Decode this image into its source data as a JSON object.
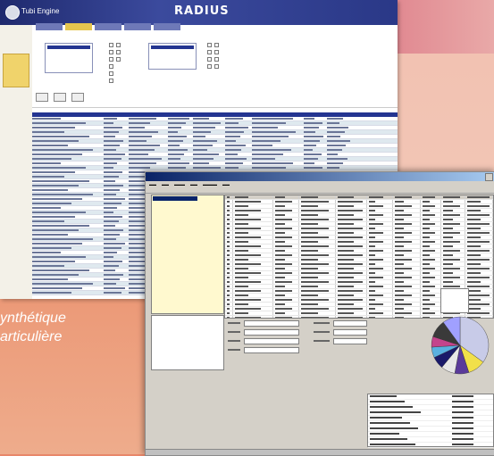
{
  "back_window": {
    "brand": "Tubi Engine",
    "app_title": "RADIUS",
    "top_info_line1": "",
    "top_info_line2": ""
  },
  "caption": {
    "line1": "ynthétique",
    "line2": "articulière"
  },
  "colors": {
    "header_blue": "#243591",
    "tab_gold": "#e5c54e",
    "tree_yellow": "#fff9cf"
  },
  "pie_slices": [
    {
      "value": 35,
      "color": "#c8cbe8"
    },
    {
      "value": 10,
      "color": "#f1e04a"
    },
    {
      "value": 8,
      "color": "#5a3a9a"
    },
    {
      "value": 8,
      "color": "#e7e7e7"
    },
    {
      "value": 7,
      "color": "#1a1a6a"
    },
    {
      "value": 6,
      "color": "#5ab0e0"
    },
    {
      "value": 6,
      "color": "#c4448c"
    },
    {
      "value": 10,
      "color": "#3a3a3a"
    },
    {
      "value": 10,
      "color": "#a0a0ff"
    }
  ]
}
